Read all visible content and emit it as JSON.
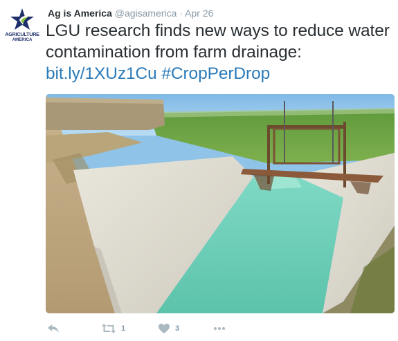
{
  "tweet": {
    "author": {
      "name": "Ag is America",
      "handle": "@agisamerica",
      "avatar_text_line1": "AGRICULTURE",
      "avatar_text_line2": "AMERICA"
    },
    "separator": "·",
    "timestamp": "Apr 26",
    "text": {
      "body": "LGU research finds new ways to reduce water contamination from farm drainage: ",
      "link": "bit.ly/1XUz1Cu",
      "hashtag": "#CropPerDrop"
    },
    "media": {
      "alt_icon": "irrigation-canal-photo"
    },
    "actions": {
      "reply_icon": "reply-icon",
      "retweet_icon": "retweet-icon",
      "retweet_count": "1",
      "like_icon": "heart-icon",
      "like_count": "3",
      "more_icon": "more-icon"
    },
    "colors": {
      "link": "#2b7bb9",
      "muted": "#8899a6",
      "text": "#292f33"
    }
  }
}
